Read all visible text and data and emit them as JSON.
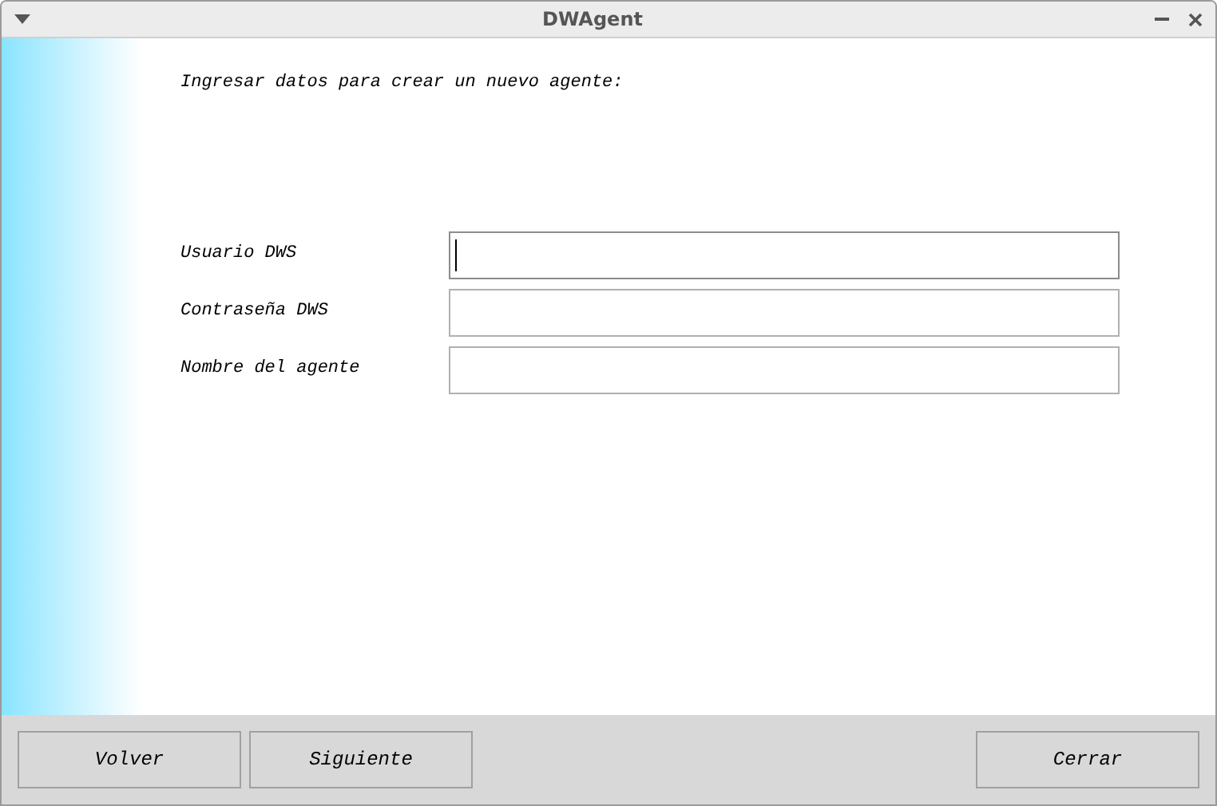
{
  "window": {
    "title": "DWAgent"
  },
  "intro": "Ingresar datos para crear un nuevo agente:",
  "fields": [
    {
      "label": "Usuario DWS",
      "focused": true
    },
    {
      "label": "Contraseña DWS",
      "focused": false
    },
    {
      "label": "Nombre del agente",
      "focused": false
    }
  ],
  "buttons_left": [
    "Volver",
    "Siguiente"
  ],
  "buttons_right": [
    "Cerrar"
  ]
}
